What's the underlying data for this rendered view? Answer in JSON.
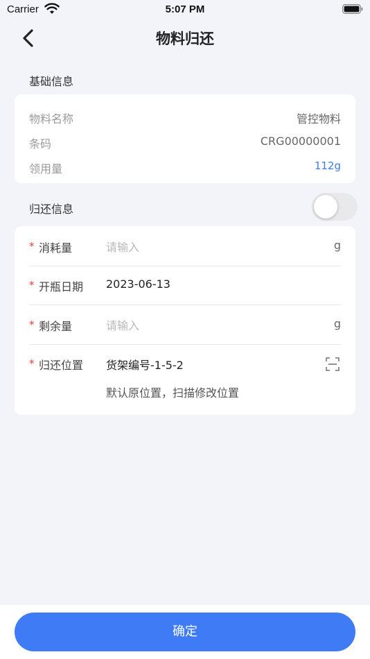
{
  "status_bar": {
    "carrier": "Carrier",
    "time": "5:07 PM"
  },
  "nav": {
    "title": "物料归还"
  },
  "basic_info": {
    "section_title": "基础信息",
    "rows": [
      {
        "label": "物料名称",
        "value": "管控物料"
      },
      {
        "label": "条码",
        "value": "CRG00000001"
      },
      {
        "label": "领用量",
        "value": "112g"
      }
    ]
  },
  "return_info": {
    "section_title": "归还信息",
    "toggle_on": false,
    "required_mark": "*",
    "consumption": {
      "label": "消耗量",
      "placeholder": "请输入",
      "unit": "g"
    },
    "open_date": {
      "label": "开瓶日期",
      "value": "2023-06-13"
    },
    "remaining": {
      "label": "剩余量",
      "placeholder": "请输入",
      "unit": "g"
    },
    "location": {
      "label": "归还位置",
      "value": "货架编号-1-5-2",
      "hint": "默认原位置，扫描修改位置"
    }
  },
  "confirm_label": "确定",
  "colors": {
    "accent": "#3e7bf5",
    "required": "#e23c3c",
    "link": "#3d7cf0"
  }
}
